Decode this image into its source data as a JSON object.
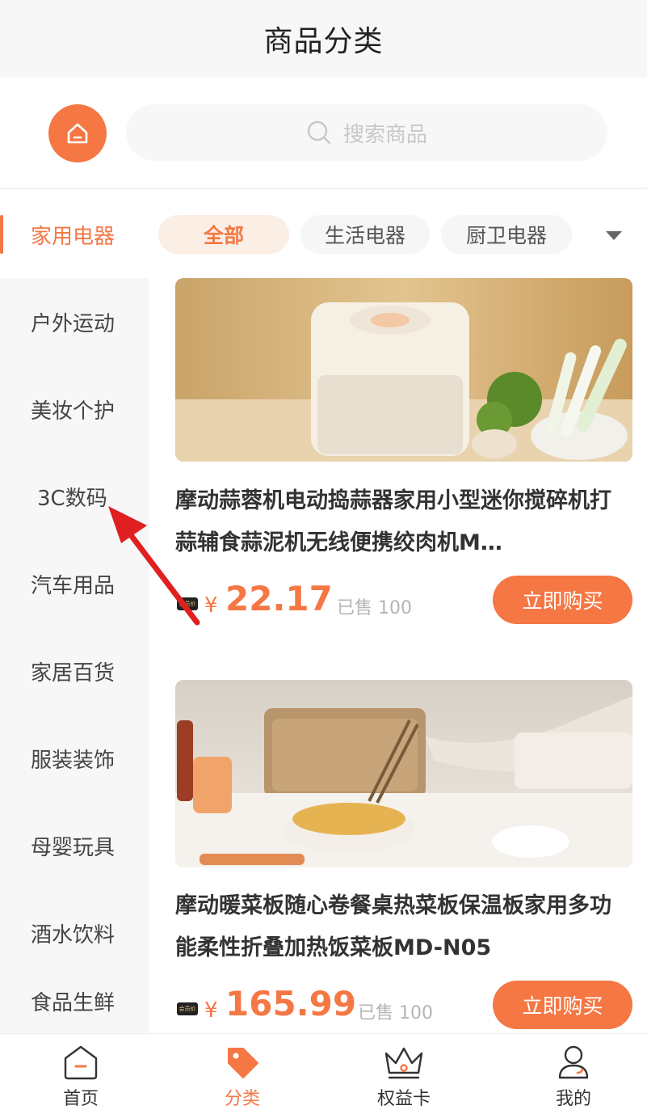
{
  "header": {
    "title": "商品分类"
  },
  "search": {
    "placeholder": "搜索商品"
  },
  "sidebar": {
    "items": [
      {
        "label": "家用电器",
        "active": true
      },
      {
        "label": "户外运动"
      },
      {
        "label": "美妆个护"
      },
      {
        "label": "3C数码"
      },
      {
        "label": "汽车用品"
      },
      {
        "label": "家居百货"
      },
      {
        "label": "服装装饰"
      },
      {
        "label": "母婴玩具"
      },
      {
        "label": "酒水饮料"
      },
      {
        "label": "食品生鲜"
      }
    ]
  },
  "subcategories": {
    "chips": [
      {
        "label": "全部",
        "active": true
      },
      {
        "label": "生活电器"
      },
      {
        "label": "厨卫电器"
      }
    ]
  },
  "products": [
    {
      "title": "摩动蒜蓉机电动捣蒜器家用小型迷你搅碎机打蒜辅食蒜泥机无线便携绞肉机M…",
      "vip_label": "会员价",
      "currency": "¥",
      "price": "22.17",
      "sold": "已售 100",
      "buy_label": "立即购买"
    },
    {
      "title": "摩动暖菜板随心卷餐桌热菜板保温板家用多功能柔性折叠加热饭菜板MD-N05",
      "vip_label": "会员价",
      "currency": "¥",
      "price": "165.99",
      "sold": "已售 100",
      "buy_label": "立即购买"
    }
  ],
  "tabbar": {
    "items": [
      {
        "label": "首页",
        "icon": "home-icon"
      },
      {
        "label": "分类",
        "icon": "tag-icon",
        "active": true
      },
      {
        "label": "权益卡",
        "icon": "crown-icon"
      },
      {
        "label": "我的",
        "icon": "user-icon"
      }
    ]
  },
  "colors": {
    "accent": "#f47744",
    "annotation_arrow": "#e02020"
  }
}
